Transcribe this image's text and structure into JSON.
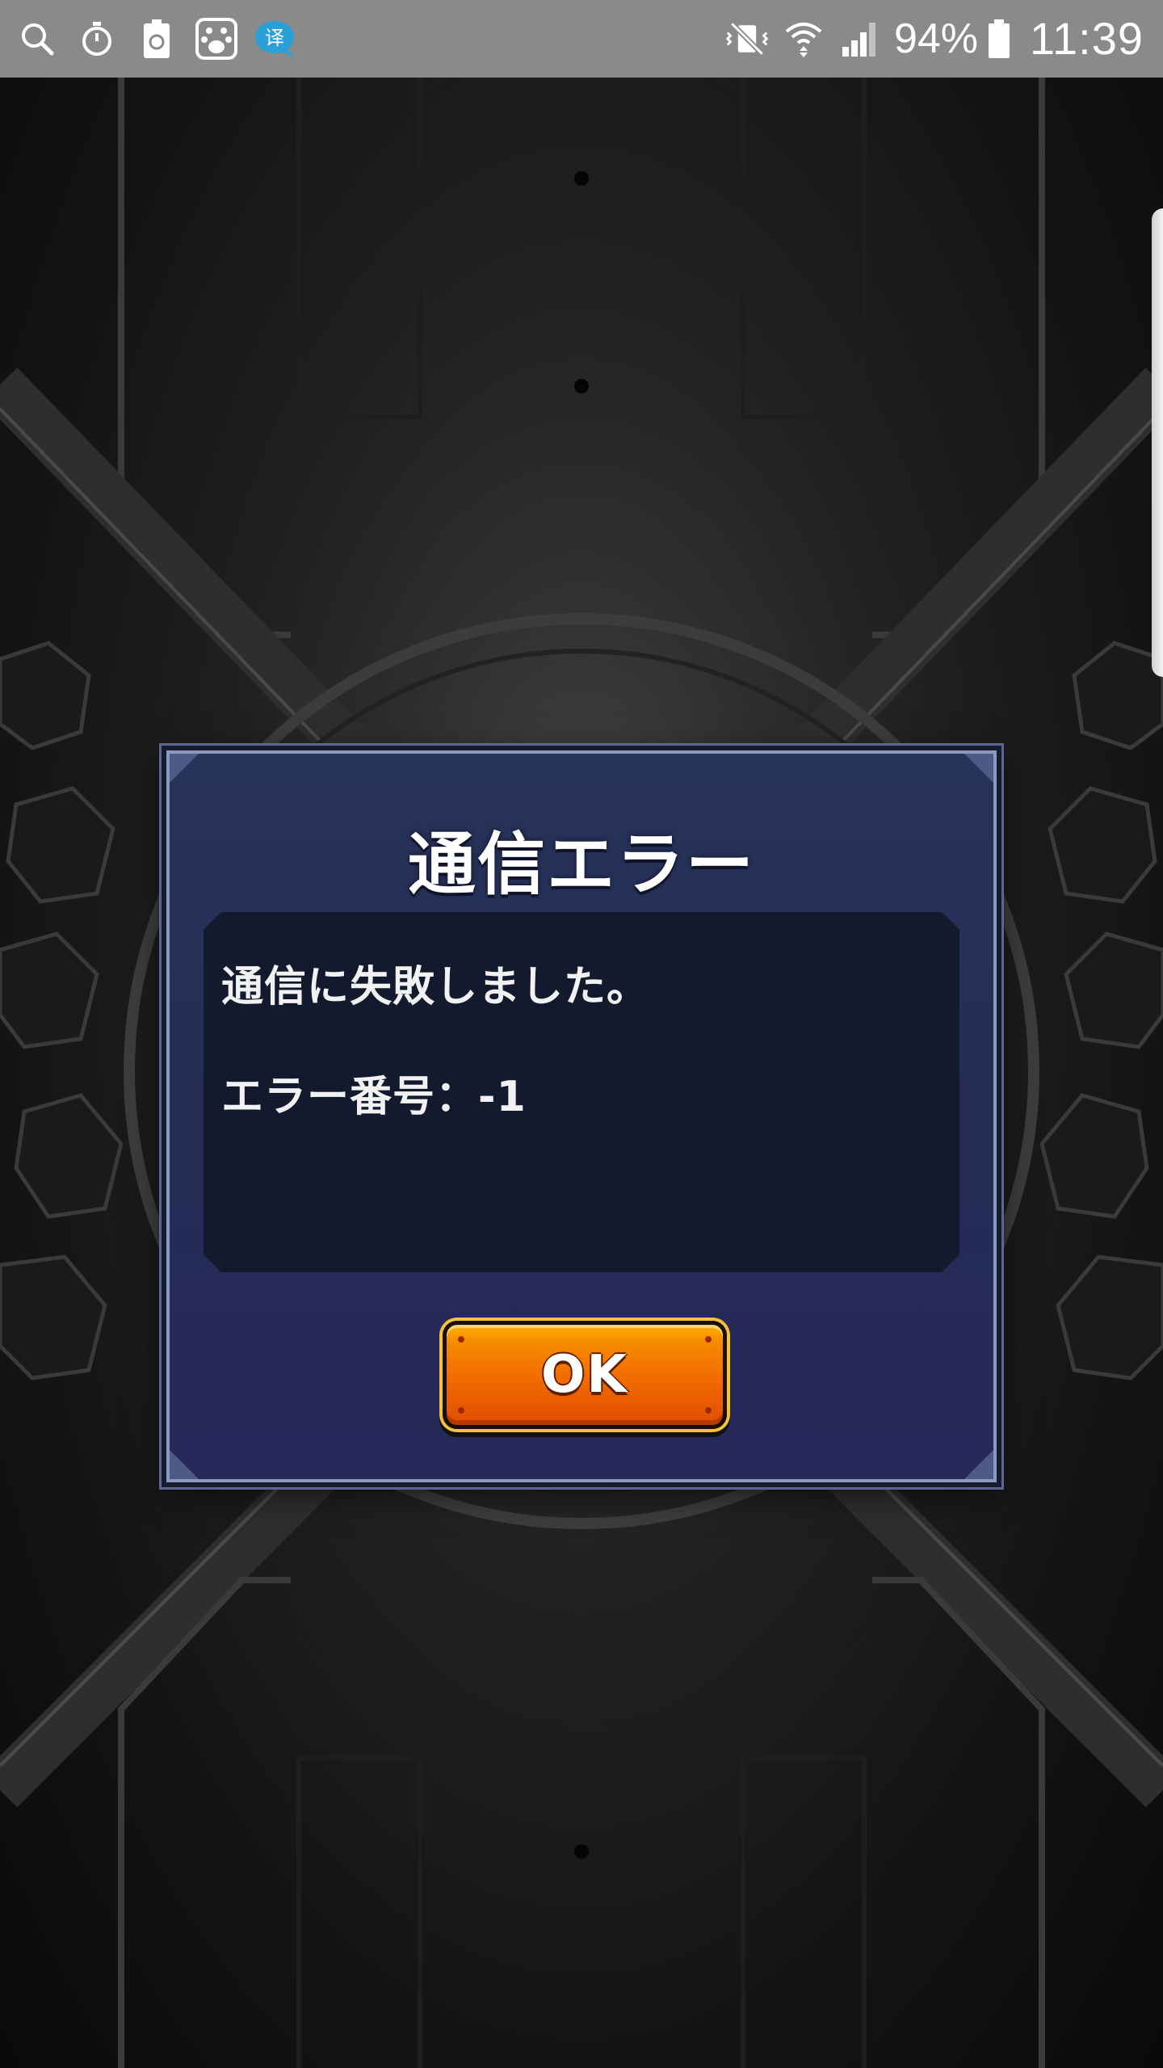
{
  "status_bar": {
    "battery_percent": "94%",
    "time": "11:39",
    "left_icons": [
      "search-icon",
      "stopwatch-icon",
      "battery-recycle-icon",
      "baidu-paw-icon",
      "translate-bubble-icon"
    ],
    "right_icons": [
      "mute-vibrate-icon",
      "wifi-icon",
      "signal-icon",
      "battery-icon"
    ]
  },
  "dialog": {
    "title": "通信エラー",
    "message_line1": "通信に失敗しました。",
    "message_line2": "エラー番号：-1",
    "ok_label": "OK"
  },
  "colors": {
    "status_bar": "#8a8a8a",
    "dialog_bg": "#252c56",
    "message_bg": "#131a2d",
    "button_orange": "#f26a00",
    "button_gold": "#f8c238"
  }
}
